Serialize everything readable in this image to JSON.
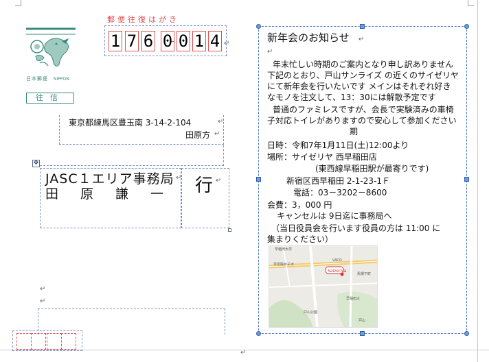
{
  "postcard_header": "郵便往復はがき",
  "postal_code": [
    "1",
    "7",
    "6",
    "0",
    "0",
    "1",
    "4"
  ],
  "stamp": {
    "label_jp": "日本郵便",
    "label_en": "NIPPON",
    "type_label": "往信"
  },
  "recipient": {
    "address": "東京都練馬区豊玉南 3-14-2-104",
    "care_of": "田原方",
    "organization": "JASC１エリア事務局",
    "person": "田原謙一",
    "suffix": "行"
  },
  "notice": {
    "title": "新年会のお知らせ",
    "lines": [
      "年末忙しい時期のご案内となり申し訳ありません",
      "下記のとおり、戸山サンライズ の近くのサイゼリヤ",
      "にて新年会を行いたいです  メインはそれぞれ好き",
      "なモノを注文して、13：30には解散予定です",
      "普通のファミレスですが、会長で実験済みの車椅",
      "子対応トイレがありますので安心して参加ください",
      "期"
    ],
    "date": "日時：令和7年1月11日(土)12:00より",
    "place": "場所：サイゼリヤ  西早稲田店",
    "nearest_station": "(東西線早稲田駅が最寄りです)",
    "address": "新宿区西早稲田 2-1-23-1Ｆ",
    "phone": "電話：03－3202－8600",
    "fee": "会費：3，000 円",
    "cancel": "キャンセルは 9日迄に事務局へ",
    "note1": "（当日役員会を行います役員の方は  11:00  に",
    "note2": "集まりください）"
  },
  "map": {
    "labels": [
      "早稲田大学",
      "学習院女子大",
      "VACO",
      "馬場下町",
      "早稲田大",
      "戸山公園",
      "戸山"
    ],
    "restaurant_logo": "Saizeriya"
  },
  "colors": {
    "postal_red": "#e05050",
    "stamp_teal": "#3a8a7a",
    "selection_blue": "#4a74c4"
  },
  "paragraph_mark": "↵"
}
